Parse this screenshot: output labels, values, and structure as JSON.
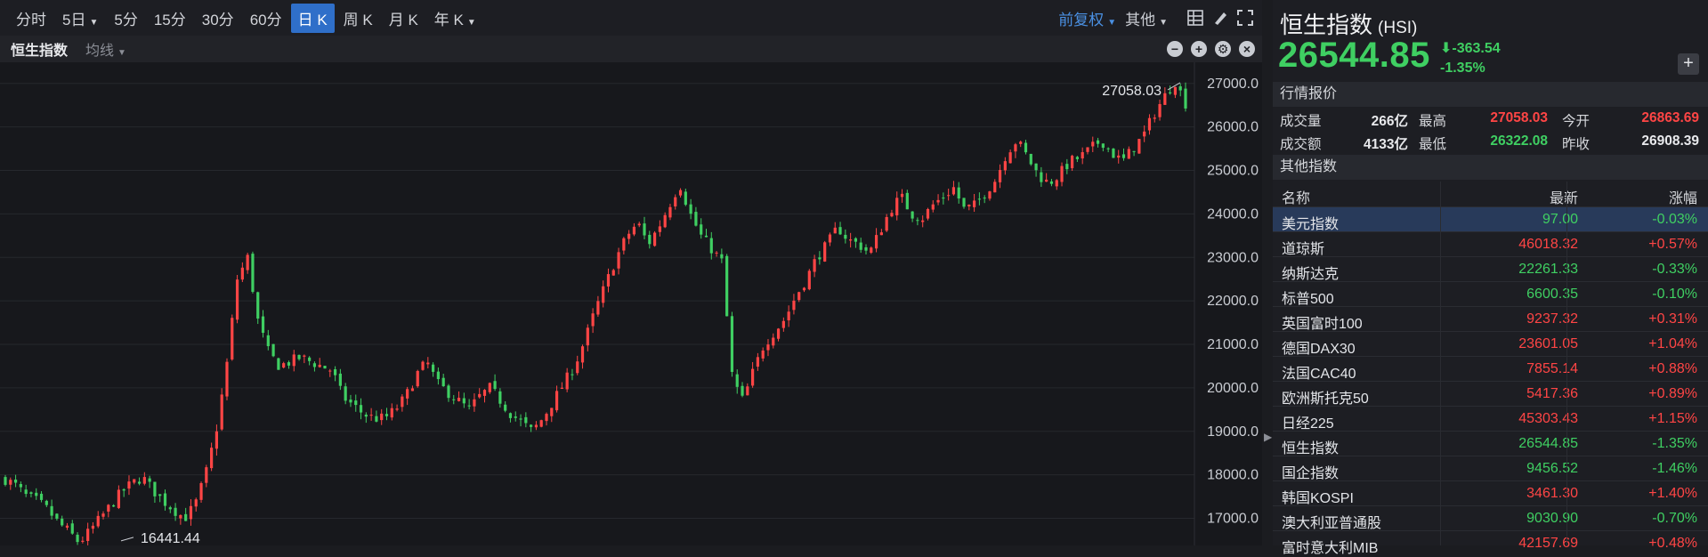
{
  "toolbar": {
    "timeframes": [
      "分时",
      "5日",
      "5分",
      "15分",
      "30分",
      "60分",
      "日 K",
      "周 K",
      "月 K",
      "年 K"
    ],
    "active": "日 K",
    "adjust": "前复权",
    "other": "其他"
  },
  "subbar": {
    "name": "恒生指数",
    "ma": "均线"
  },
  "chart": {
    "y_ticks": [
      "27000.0",
      "26000.0",
      "25000.0",
      "24000.0",
      "23000.0",
      "22000.0",
      "21000.0",
      "20000.0",
      "19000.0",
      "18000.0",
      "17000.0"
    ],
    "high_label": "27058.03",
    "low_label": "16441.44",
    "colors": {
      "up": "#ff4545",
      "down": "#3fcf62",
      "grid": "#26282d",
      "bg": "#17181c"
    }
  },
  "chart_data": {
    "type": "candlestick",
    "ylim": [
      16500,
      27200
    ],
    "max": 27058.03,
    "min": 16441.44,
    "last": 26544.85,
    "y_ticks": [
      27000,
      26000,
      25000,
      24000,
      23000,
      22000,
      21000,
      20000,
      19000,
      18000,
      17000
    ],
    "trend_closes": [
      17900,
      17750,
      17500,
      17400,
      17200,
      16900,
      16700,
      16441,
      16700,
      17000,
      17300,
      17600,
      17800,
      17950,
      17650,
      17400,
      17200,
      17000,
      17300,
      18000,
      19000,
      20500,
      22500,
      23000,
      21500,
      20800,
      20500,
      20600,
      20700,
      20600,
      20500,
      20400,
      19800,
      19600,
      19400,
      19300,
      19300,
      19500,
      19800,
      20300,
      20600,
      20100,
      19900,
      19700,
      19500,
      19800,
      20000,
      19700,
      19400,
      19200,
      19000,
      19300,
      19700,
      20100,
      20500,
      21100,
      21800,
      22400,
      23000,
      23500,
      23800,
      23300,
      23700,
      24200,
      24700,
      24000,
      23500,
      23200,
      22900,
      20200,
      19700,
      20400,
      21000,
      21300,
      21600,
      22100,
      22500,
      23000,
      23300,
      23700,
      23400,
      23300,
      23100,
      23600,
      24100,
      24400,
      24000,
      23900,
      24200,
      24400,
      24600,
      24100,
      24200,
      24500,
      24800,
      25400,
      25700,
      25300,
      24900,
      24700,
      24900,
      25200,
      25300,
      25500,
      25700,
      25400,
      25200,
      25500,
      25800,
      26300,
      26700,
      27058,
      26544
    ]
  },
  "panel": {
    "name": "恒生指数",
    "code": "(HSI)",
    "price": "26544.85",
    "change": "-363.54",
    "change_pct": "-1.35%",
    "quote_title": "行情报价",
    "quote": {
      "volume_label": "成交量",
      "volume": "266亿",
      "high_label": "最高",
      "high": "27058.03",
      "open_label": "今开",
      "open": "26863.69",
      "turnover_label": "成交额",
      "turnover": "4133亿",
      "low_label": "最低",
      "low": "26322.08",
      "prev_label": "昨收",
      "prev": "26908.39"
    },
    "other_title": "其他指数",
    "table_headers": {
      "name": "名称",
      "last": "最新",
      "pct": "涨幅"
    },
    "indices": [
      {
        "name": "美元指数",
        "last": "97.00",
        "pct": "-0.03%",
        "dir": "down"
      },
      {
        "name": "道琼斯",
        "last": "46018.32",
        "pct": "+0.57%",
        "dir": "up"
      },
      {
        "name": "纳斯达克",
        "last": "22261.33",
        "pct": "-0.33%",
        "dir": "down"
      },
      {
        "name": "标普500",
        "last": "6600.35",
        "pct": "-0.10%",
        "dir": "down"
      },
      {
        "name": "英国富时100",
        "last": "9237.32",
        "pct": "+0.31%",
        "dir": "up"
      },
      {
        "name": "德国DAX30",
        "last": "23601.05",
        "pct": "+1.04%",
        "dir": "up"
      },
      {
        "name": "法国CAC40",
        "last": "7855.14",
        "pct": "+0.88%",
        "dir": "up"
      },
      {
        "name": "欧洲斯托克50",
        "last": "5417.36",
        "pct": "+0.89%",
        "dir": "up"
      },
      {
        "name": "日经225",
        "last": "45303.43",
        "pct": "+1.15%",
        "dir": "up"
      },
      {
        "name": "恒生指数",
        "last": "26544.85",
        "pct": "-1.35%",
        "dir": "down"
      },
      {
        "name": "国企指数",
        "last": "9456.52",
        "pct": "-1.46%",
        "dir": "down"
      },
      {
        "name": "韩国KOSPI",
        "last": "3461.30",
        "pct": "+1.40%",
        "dir": "up"
      },
      {
        "name": "澳大利亚普通股",
        "last": "9030.90",
        "pct": "-0.70%",
        "dir": "down"
      },
      {
        "name": "富时意大利MIB",
        "last": "42157.69",
        "pct": "+0.48%",
        "dir": "up"
      }
    ]
  }
}
